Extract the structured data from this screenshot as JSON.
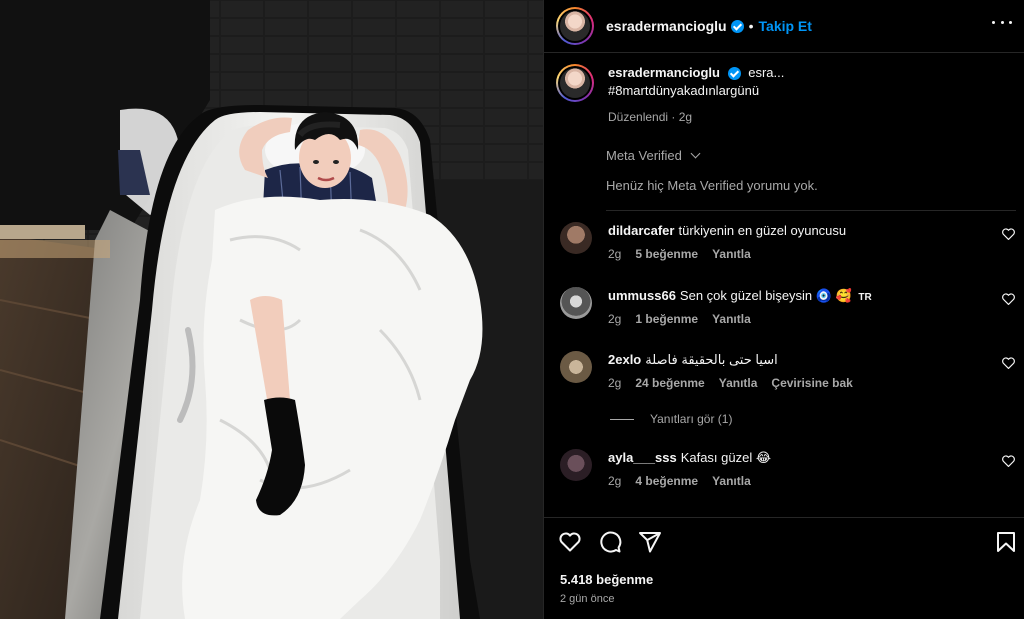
{
  "header": {
    "username": "esradermancioglu",
    "separator": "•",
    "follow_label": "Takip Et"
  },
  "caption": {
    "username": "esradermancioglu",
    "text": "esra...",
    "hashtag": "#8martdünyakadınlargünü",
    "meta": "Düzenlendi · 2g"
  },
  "meta_verified": {
    "label": "Meta Verified",
    "empty_text": "Henüz hiç Meta Verified yorumu yok."
  },
  "comments": [
    {
      "user": "dildarcafer",
      "text": "türkiyenin en güzel oyuncusu",
      "time": "2g",
      "likes": "5 beğenme",
      "reply": "Yanıtla",
      "translate": ""
    },
    {
      "user": "ummuss66",
      "text": "Sen çok güzel bişeysin 🧿 🥰",
      "badge": "TR",
      "time": "2g",
      "likes": "1 beğenme",
      "reply": "Yanıtla",
      "translate": ""
    },
    {
      "user": "2exlo",
      "text": "اسيا حتى بالحقيقة فاصلة",
      "time": "2g",
      "likes": "24 beğenme",
      "reply": "Yanıtla",
      "translate": "Çevirisine bak"
    },
    {
      "user": "ayla___sss",
      "text": "Kafası güzel 😂",
      "time": "2g",
      "likes": "4 beğenme",
      "reply": "Yanıtla",
      "translate": ""
    }
  ],
  "replies_label": "Yanıtları gör (1)",
  "footer": {
    "likes": "5.418 beğenme",
    "time": "2 gün önce"
  },
  "colors": {
    "accent": "#0095f6",
    "background": "#000000",
    "secondary_text": "#a8a8a8",
    "border": "#262626"
  },
  "icons": [
    "verified-badge-icon",
    "more-options-icon",
    "chevron-down-icon",
    "heart-icon",
    "comment-icon",
    "share-icon",
    "bookmark-icon"
  ]
}
